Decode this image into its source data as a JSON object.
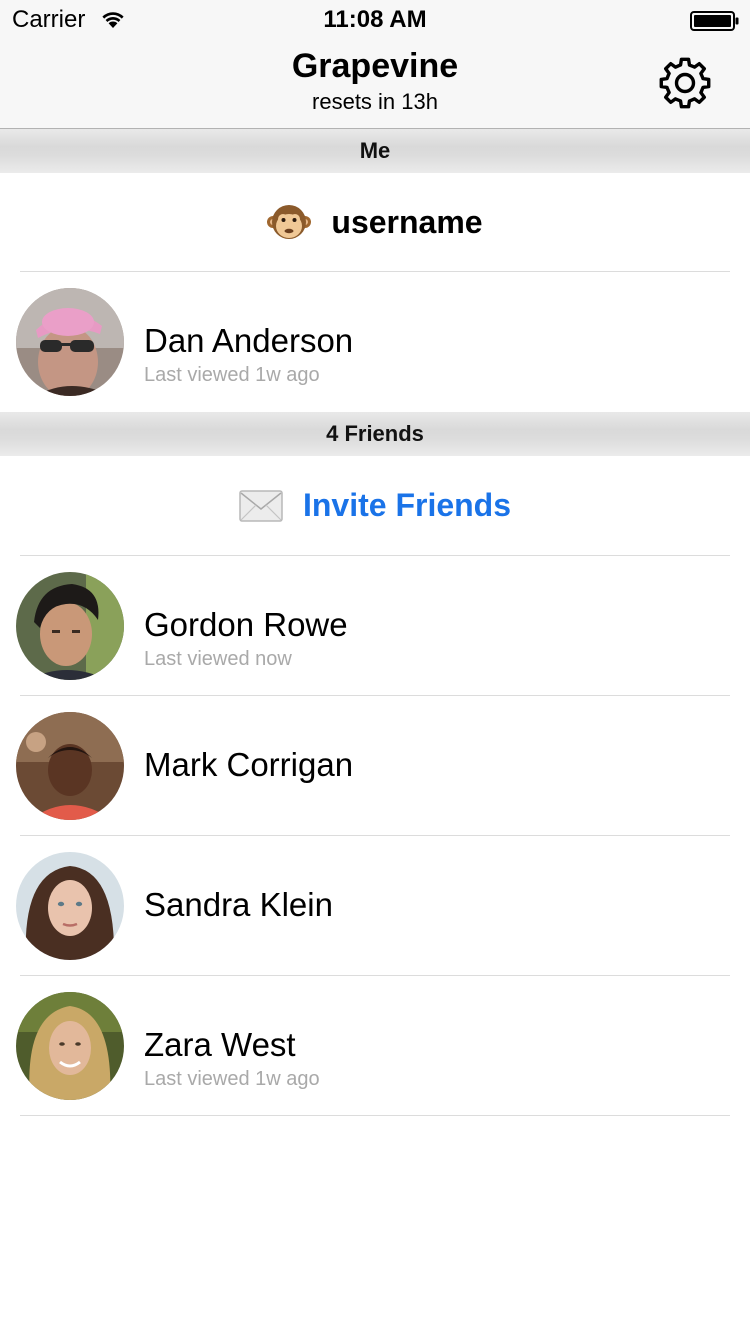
{
  "status_bar": {
    "carrier": "Carrier",
    "time": "11:08 AM"
  },
  "nav": {
    "title": "Grapevine",
    "subtitle": "resets in 13h",
    "settings_icon": "gear-icon"
  },
  "me_section": {
    "header": "Me",
    "username_emoji": "monkey-face",
    "username": "username",
    "profile": {
      "name": "Dan Anderson",
      "last_viewed": "Last viewed 1w ago"
    }
  },
  "friends_section": {
    "header": "4 Friends",
    "invite_icon": "envelope-icon",
    "invite_label": "Invite Friends",
    "friends": [
      {
        "name": "Gordon Rowe",
        "last_viewed": "Last viewed now"
      },
      {
        "name": "Mark Corrigan",
        "last_viewed": ""
      },
      {
        "name": "Sandra Klein",
        "last_viewed": ""
      },
      {
        "name": "Zara West",
        "last_viewed": "Last viewed 1w ago"
      }
    ]
  },
  "colors": {
    "link_blue": "#1a73e8",
    "meta_gray": "#a9a9a9",
    "bar_gray": "#f7f7f7"
  }
}
